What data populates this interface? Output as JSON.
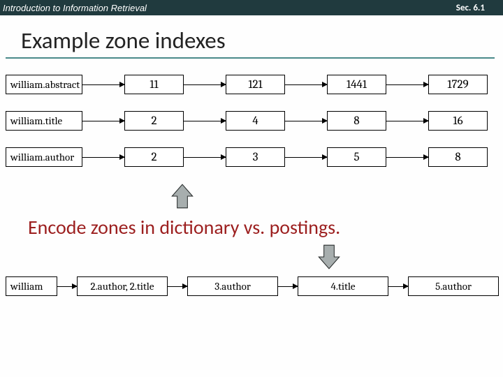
{
  "header": {
    "course": "Introduction to Information Retrieval",
    "section": "Sec. 6.1"
  },
  "title": "Example zone indexes",
  "rows_top": [
    {
      "term": "william.abstract",
      "postings": [
        "11",
        "121",
        "1441",
        "1729"
      ]
    },
    {
      "term": "william.title",
      "postings": [
        "2",
        "4",
        "8",
        "16"
      ]
    },
    {
      "term": "william.author",
      "postings": [
        "2",
        "3",
        "5",
        "8"
      ]
    }
  ],
  "caption": "Encode zones in dictionary vs. postings.",
  "row_bottom": {
    "term": "william",
    "postings": [
      "2.author, 2.title",
      "3.author",
      "4.title",
      "5.author"
    ]
  }
}
